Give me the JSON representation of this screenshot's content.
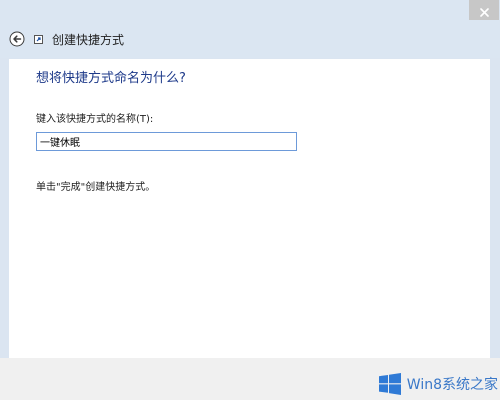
{
  "window": {
    "title": "创建快捷方式",
    "close_icon": "close-icon",
    "back_icon": "back-arrow-icon",
    "app_icon": "shortcut-icon"
  },
  "content": {
    "heading": "想将快捷方式命名为什么?",
    "field_label": "键入该快捷方式的名称(T):",
    "name_value": "一键休眠",
    "hint": "单击\"完成\"创建快捷方式。"
  },
  "watermark": {
    "logo_icon": "windows-logo-icon",
    "text": "Win8系统之家"
  },
  "colors": {
    "accent": "#1e3a8a",
    "input_border": "#6d9ad9",
    "watermark": "#3a78c8",
    "chrome": "#dbe6f2"
  }
}
